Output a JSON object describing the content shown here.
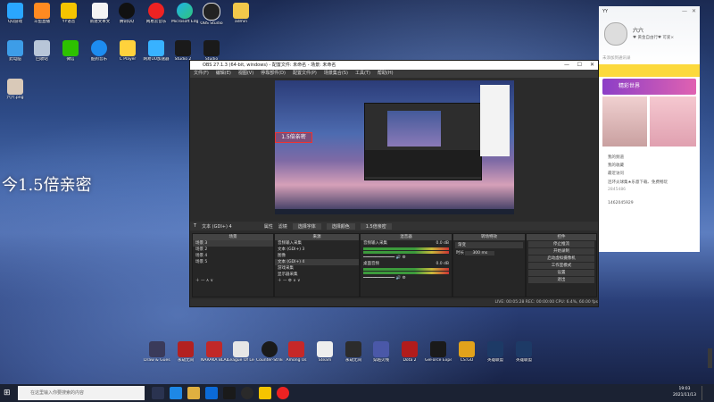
{
  "desktop": {
    "overlay_text": "今1.5倍亲密",
    "icons_row1": [
      "QQ游戏",
      "斗鱼直播",
      "YY语音",
      "新建文本文",
      "腾讯QQ",
      "网易云音乐",
      "Microsoft Edge",
      "OBS Studio",
      "admin"
    ],
    "icons_row2": [
      "此电脑",
      "回收站",
      "微信",
      "酷狗音乐",
      "C Player",
      "网易UU加速器",
      "Studio 2",
      "Studio"
    ],
    "icons_row3": [
      "六六.png"
    ],
    "bottom_icons": [
      "Draw & Guess",
      "永劫无间",
      "NARAKA BLADEPOI...",
      "League Of Legends",
      "Counter-Strike",
      "Among Us",
      "Steam",
      "永劫无间",
      "穿越火线",
      "Dota 2",
      "GeForce Experience",
      "CS:GO",
      "英雄联盟",
      "英雄联盟"
    ]
  },
  "obs": {
    "title": "OBS 27.1.3 (64-bit, windows) - 配置文件: 未命名 - 场景: 未命名",
    "menu": [
      "文件(F)",
      "编辑(E)",
      "视图(V)",
      "停靠部件(D)",
      "配置文件(P)",
      "场景集合(S)",
      "工具(T)",
      "帮助(H)"
    ],
    "preview_label": "1.5倍亲密",
    "source_bar": {
      "selected_source": "文本 (GDI+) 4",
      "properties": "属性",
      "filters": "滤镜",
      "font_btn": "选择字体",
      "color_btn": "选择颜色",
      "text_value": "1.5倍亲密"
    },
    "scenes": {
      "header": "场景",
      "items": [
        "场景 3",
        "场景 2",
        "场景 4",
        "场景 5"
      ]
    },
    "sources": {
      "header": "来源",
      "items": [
        "音频输入采集",
        "文本 (GDI+) 3",
        "图像",
        "文本 (GDI+) 4",
        "游戏采集",
        "显示器采集"
      ]
    },
    "mixer": {
      "header": "混音器",
      "channels": [
        {
          "name": "音频输入采集",
          "level": "0.0 dB"
        },
        {
          "name": "桌面音频",
          "level": "0.0 dB"
        }
      ]
    },
    "transitions": {
      "header": "转场特效",
      "type": "渐变",
      "duration_label": "时长",
      "duration": "300 ms"
    },
    "controls": {
      "header": "控件",
      "buttons": [
        "停止推流",
        "开始录制",
        "启动虚拟摄像机",
        "工作室模式",
        "设置",
        "退出"
      ]
    },
    "status": "LIVE: 00:05:28   REC: 00:00:00   CPU: 6.4%, 60.00 fps"
  },
  "chat": {
    "title": "YY",
    "username": "六六",
    "signature": "♥ 黄金自由行♥ 可爱×",
    "notice": "未添加到通讯录",
    "banner_title": "精彩世界",
    "items": [
      "我的频道",
      "我的收藏",
      "最近访问"
    ],
    "msg1": "连环炎球集★乐意下载、免费畅玩",
    "msg1_sub": "2845486",
    "msg2": "1462045929"
  },
  "taskbar": {
    "search_placeholder": "在这里输入你要搜索的内容",
    "time": "19:03",
    "date": "2021/11/13"
  },
  "colors": {
    "obs_bg": "#2b2b2b",
    "chat_yellow": "#fcd93d",
    "taskbar": "#1b2233"
  }
}
